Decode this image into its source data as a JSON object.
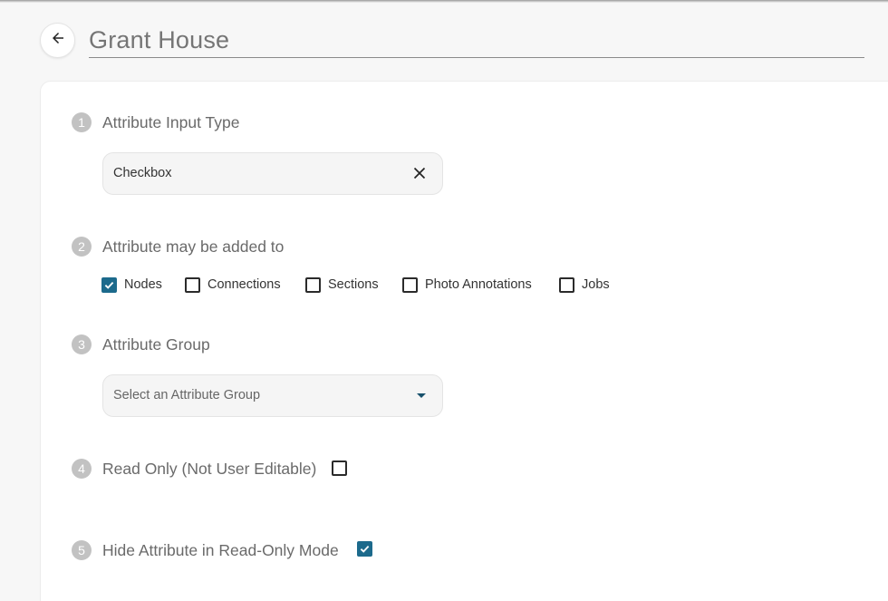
{
  "header": {
    "back_icon": "arrow-left-icon",
    "title": "Grant House"
  },
  "steps": [
    {
      "number": "1",
      "label": "Attribute Input Type",
      "select_value": "Checkbox",
      "clear_icon": "close-icon"
    },
    {
      "number": "2",
      "label": "Attribute may be added to",
      "options": [
        {
          "label": "Nodes",
          "checked": true
        },
        {
          "label": "Connections",
          "checked": false
        },
        {
          "label": "Sections",
          "checked": false
        },
        {
          "label": "Photo Annotations",
          "checked": false
        },
        {
          "label": "Jobs",
          "checked": false
        }
      ]
    },
    {
      "number": "3",
      "label": "Attribute Group",
      "placeholder": "Select an Attribute Group",
      "dropdown_icon": "caret-down-icon"
    },
    {
      "number": "4",
      "label": "Read Only (Not User Editable)",
      "checked": false
    },
    {
      "number": "5",
      "label": "Hide Attribute in Read-Only Mode",
      "checked": true
    }
  ],
  "colors": {
    "accent": "#1c6a8c",
    "step_badge": "#c2c2c2"
  }
}
